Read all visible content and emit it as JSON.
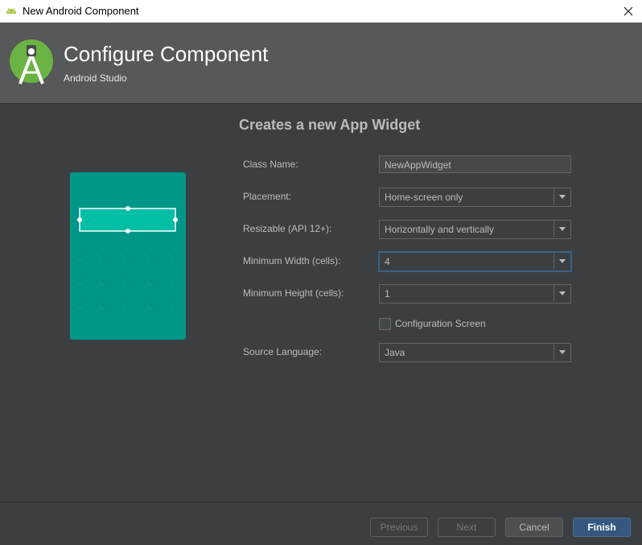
{
  "window": {
    "title": "New Android Component"
  },
  "header": {
    "title": "Configure Component",
    "subtitle": "Android Studio"
  },
  "page": {
    "subtitle": "Creates a new App Widget"
  },
  "form": {
    "class_name": {
      "label": "Class Name:",
      "value": "NewAppWidget"
    },
    "placement": {
      "label": "Placement:",
      "value": "Home-screen only"
    },
    "resizable": {
      "label": "Resizable (API 12+):",
      "value": "Horizontally and vertically"
    },
    "min_width": {
      "label": "Minimum Width (cells):",
      "value": "4"
    },
    "min_height": {
      "label": "Minimum Height (cells):",
      "value": "1"
    },
    "config_screen": {
      "label": "Configuration Screen",
      "checked": false
    },
    "source_language": {
      "label": "Source Language:",
      "value": "Java"
    }
  },
  "buttons": {
    "previous": "Previous",
    "next": "Next",
    "cancel": "Cancel",
    "finish": "Finish"
  },
  "colors": {
    "accent": "#365880",
    "preview": "#009688",
    "widget": "#00bfa5"
  }
}
